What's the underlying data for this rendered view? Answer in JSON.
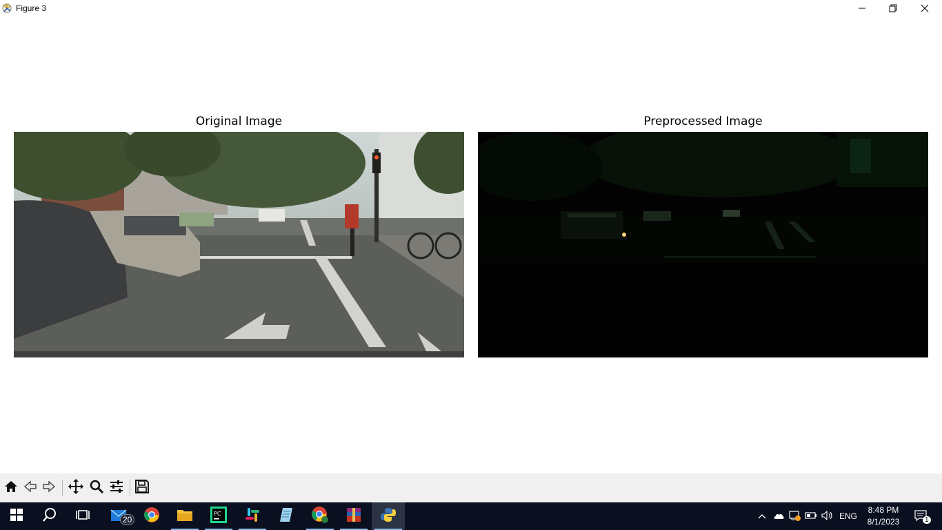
{
  "window": {
    "title": "Figure 3",
    "app_icon": "matplotlib-icon",
    "controls": [
      "minimize-icon",
      "restore-icon",
      "close-icon"
    ]
  },
  "figure": {
    "panels": [
      {
        "title": "Original Image"
      },
      {
        "title": "Preprocessed Image"
      }
    ]
  },
  "toolbar": {
    "buttons": [
      "home-icon",
      "back-icon",
      "forward-icon",
      "pan-icon",
      "zoom-icon",
      "configure-subplots-icon",
      "save-icon"
    ]
  },
  "taskbar": {
    "apps": [
      "start-icon",
      "search-icon",
      "task-view-icon",
      "mail-icon",
      "chrome-icon",
      "file-explorer-icon",
      "pycharm-icon",
      "slack-icon",
      "notepad-icon",
      "chrome-profile-icon",
      "winrar-icon",
      "python-icon"
    ],
    "mail_badge": "20",
    "tray": {
      "language": "ENG",
      "time": "8:48 PM",
      "date": "8/1/2023",
      "notification_count": "1"
    }
  },
  "colors": {
    "taskbar_bg": "#0b1020",
    "toolbar_bg": "#f0f0f0",
    "accent": "#8fb8ee"
  }
}
